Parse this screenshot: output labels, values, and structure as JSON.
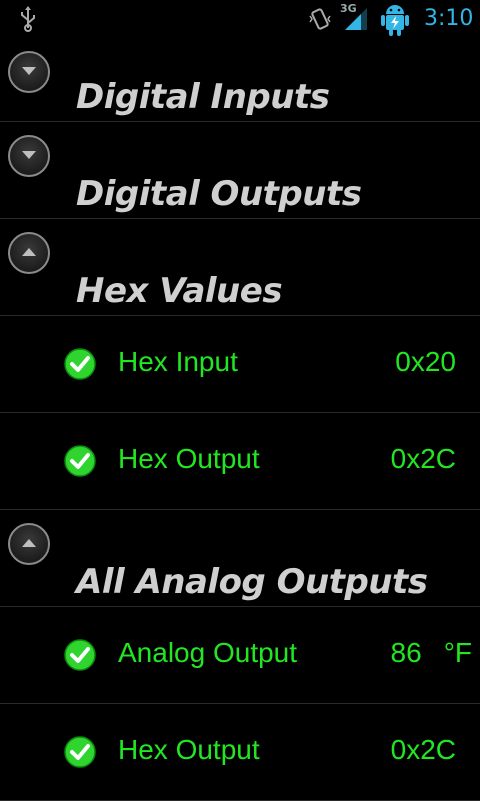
{
  "status_bar": {
    "network_label": "3G",
    "time": "3:10",
    "time_color": "#33b5e5"
  },
  "sections": [
    {
      "title": "Digital Inputs",
      "expanded": false
    },
    {
      "title": "Digital Outputs",
      "expanded": false
    },
    {
      "title": "Hex Values",
      "expanded": true,
      "rows": [
        {
          "label": "Hex Input",
          "value": "0x20"
        },
        {
          "label": "Hex Output",
          "value": "0x2C"
        }
      ]
    },
    {
      "title": "All Analog Outputs",
      "expanded": true,
      "rows": [
        {
          "label": "Analog Output",
          "value": "86",
          "unit": "°F"
        },
        {
          "label": "Hex Output",
          "value": "0x2C"
        }
      ]
    }
  ],
  "colors": {
    "row_text": "#22e622",
    "header_text": "#cfcfcf",
    "background": "#000000"
  },
  "icons": [
    "usb-icon",
    "vibrate-icon",
    "signal-icon",
    "android-battery-icon",
    "check-icon",
    "chevron-down-icon",
    "chevron-up-icon"
  ]
}
